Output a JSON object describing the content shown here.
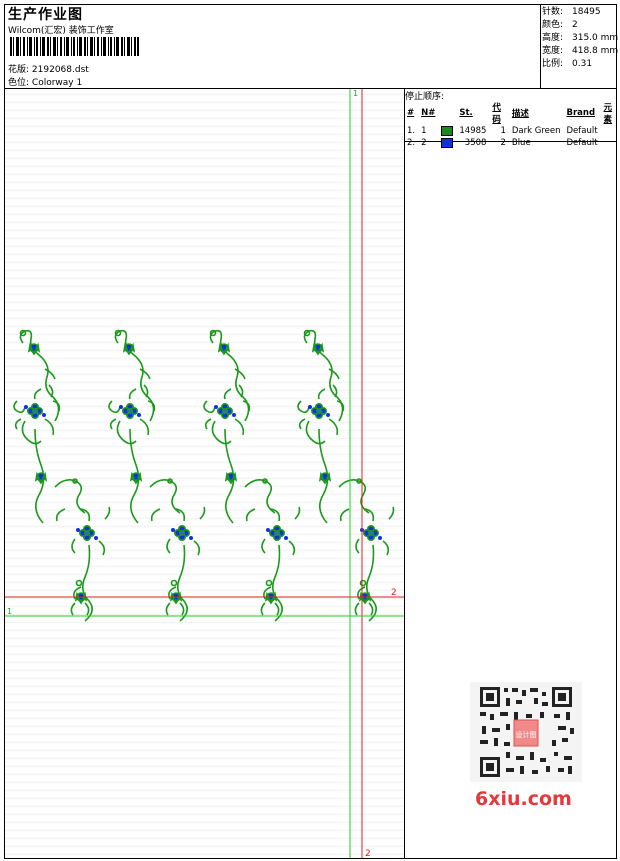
{
  "header": {
    "title": "生产作业图",
    "studio": "Wilcom(汇宏) 装饰工作室",
    "design_label": "花版:",
    "design_value": "2192068.dst",
    "colorway_label": "色位:",
    "colorway_value": "Colorway 1"
  },
  "stats": [
    {
      "label": "针数:",
      "value": "18495"
    },
    {
      "label": "颜色:",
      "value": "2"
    },
    {
      "label": "高度:",
      "value": "315.0 mm"
    },
    {
      "label": "宽度:",
      "value": "418.8 mm"
    },
    {
      "label": "比例:",
      "value": "0.31"
    }
  ],
  "stop_sequence": {
    "title": "停止顺序:",
    "columns": [
      "#",
      "N#",
      "St.",
      "代码",
      "描述",
      "Brand",
      "元素"
    ],
    "rows": [
      {
        "idx": "1.",
        "n": "1",
        "st": "14985",
        "code": "1",
        "desc": "Dark Green",
        "brand": "Default",
        "color": "#1a8a1a"
      },
      {
        "idx": "2.",
        "n": "2",
        "st": "3508",
        "code": "2",
        "desc": "Blue",
        "brand": "Default",
        "color": "#1030e8"
      }
    ]
  },
  "guides": {
    "green_v_label": "1",
    "green_h_label": "1",
    "red_h_label": "2",
    "red_v_label": "2"
  },
  "colors": {
    "leaf": "#1a9a1a",
    "flower": "#1030e8",
    "guide_green": "#22cc22",
    "guide_red": "#dd2222"
  },
  "watermark": {
    "text": "6xiu.com",
    "stamp": "设计图"
  }
}
